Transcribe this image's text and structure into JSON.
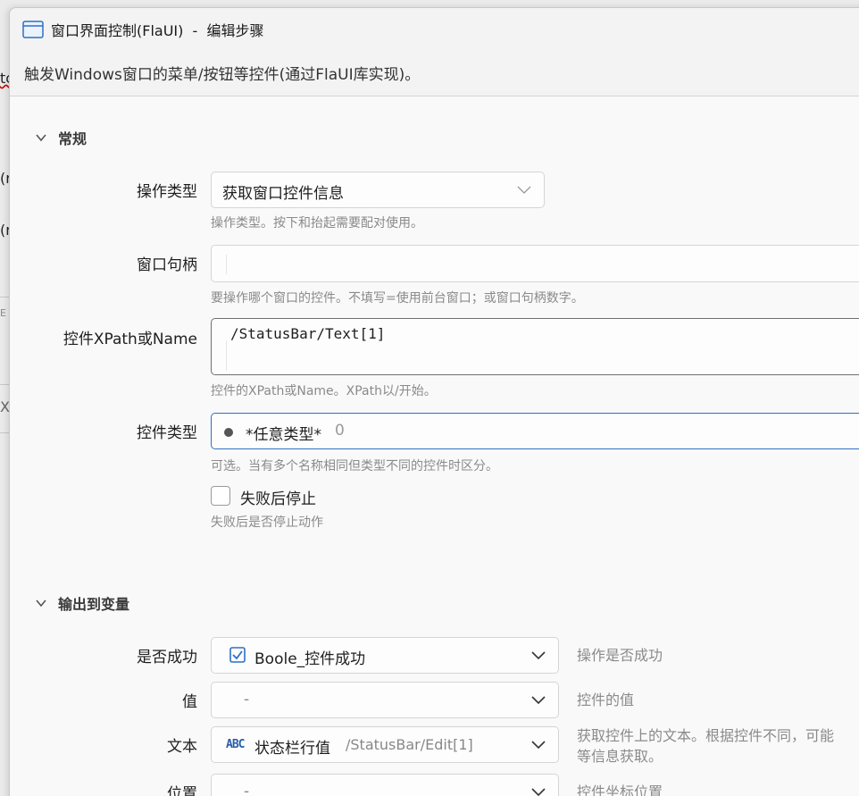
{
  "background": {
    "frag1": "to",
    "frag2": "(r",
    "frag3": "(r",
    "frag4": "E",
    "frag5": "X"
  },
  "window": {
    "title": "窗口界面控制(FlaUI)  -  编辑步骤",
    "subtitle": "触发Windows窗口的菜单/按钮等控件(通过FlaUI库实现)。"
  },
  "general": {
    "heading": "常规",
    "op_type": {
      "label": "操作类型",
      "value": "获取窗口控件信息",
      "hint": "操作类型。按下和抬起需要配对使用。"
    },
    "handle": {
      "label": "窗口句柄",
      "value": "",
      "hint": "要操作哪个窗口的控件。不填写=使用前台窗口；或窗口句柄数字。"
    },
    "xpath": {
      "label": "控件XPath或Name",
      "value": "/StatusBar/Text[1]",
      "hint": "控件的XPath或Name。XPath以/开始。"
    },
    "ctrl_type": {
      "label": "控件类型",
      "value": "*任意类型*",
      "extra": "0",
      "hint": "可选。当有多个名称相同但类型不同的控件时区分。"
    },
    "stop_on_fail": {
      "label": "失败后停止",
      "hint": "失败后是否停止动作",
      "checked": false
    }
  },
  "output": {
    "heading": "输出到变量",
    "success": {
      "label": "是否成功",
      "value": "Boole_控件成功",
      "side": "操作是否成功",
      "icon": "checkbox-icon"
    },
    "value": {
      "label": "值",
      "value": "-",
      "side": "控件的值"
    },
    "text": {
      "label": "文本",
      "value": "状态栏行值",
      "extra": "/StatusBar/Edit[1]",
      "side": "获取控件上的文本。根据控件不同，可能",
      "side2": "等信息获取。",
      "icon": "abc-icon",
      "icon_text": "ABC"
    },
    "position": {
      "label": "位置",
      "value": "-",
      "side": "控件坐标位置"
    }
  },
  "colors": {
    "accent": "#2f6fc4",
    "hint": "#8a8a8a"
  }
}
